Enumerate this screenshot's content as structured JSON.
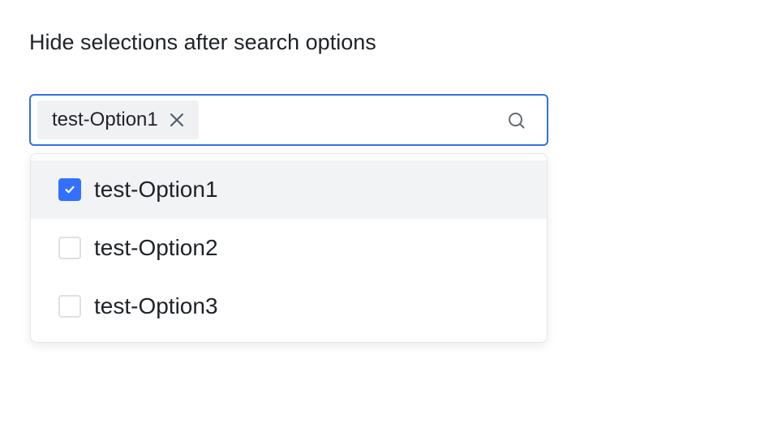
{
  "page": {
    "heading": "Hide selections after search options"
  },
  "select": {
    "selected_tags": [
      {
        "label": "test-Option1"
      }
    ],
    "search_icon": "search-icon",
    "tag_close_icon": "close-icon",
    "focus_border_color": "#3370e8"
  },
  "dropdown": {
    "options": [
      {
        "label": "test-Option1",
        "checked": true
      },
      {
        "label": "test-Option2",
        "checked": false
      },
      {
        "label": "test-Option3",
        "checked": false
      }
    ],
    "checkbox_checked_color": "#3370ff",
    "highlight_color": "#f2f3f5"
  }
}
